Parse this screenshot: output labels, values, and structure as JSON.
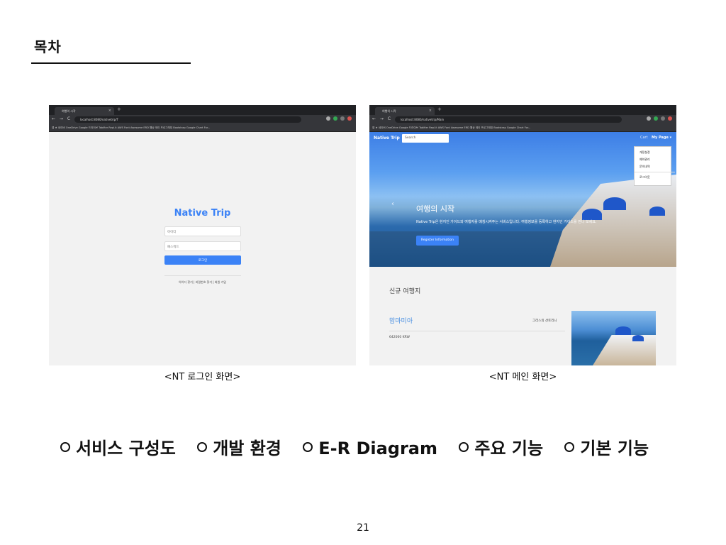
{
  "slide": {
    "title": "목차",
    "page_number": "21"
  },
  "login_screenshot": {
    "browser": {
      "tab_title": "여행의 시작",
      "tab_close": "×",
      "new_tab": "+",
      "nav": "← → C",
      "url": "localhost:8080/nativetrip/T",
      "bookmarks": "앱  ★  네이버  OneDrive  Google 드라이브  Tabifier  Repl.it  AWS  Font Awesome  ERD  웹상 제이 프로그래밍  Bootstrap  Google Chart For..."
    },
    "logo": "Native Trip",
    "id_placeholder": "아이디",
    "pw_placeholder": "패스워드",
    "login_button": "로그인",
    "links": "아이디 찾기  |  비밀번호 찾기  |  회원 가입"
  },
  "main_screenshot": {
    "browser": {
      "tab_title": "여행의 시작",
      "tab_close": "×",
      "new_tab": "+",
      "nav": "← → C",
      "url": "localhost:8080/nativetrip/Main",
      "bookmarks": "앱  ★  네이버  OneDrive  Google 드라이브  Tabifier  Repl.it  AWS  Font Awesome  ERD  웹상 제이 프로그래밍  Bootstrap  Google Chart For..."
    },
    "navbar": {
      "logo": "Native Trip",
      "search_placeholder": "Search",
      "cart": "Cart",
      "my_page": "My Page ▾"
    },
    "dropdown": {
      "items": [
        "개정설정",
        "예약관리",
        "문의내역"
      ],
      "logout": "로그아웃"
    },
    "hero": {
      "prev_arrow": "‹",
      "title": "여행의 시작",
      "description": "Native Trip은 현지인 가이드와 여행자를 매칭시켜주는 서비스입니다. 여행정보를 등록하고 현지인 가이드를 만나 보세요.",
      "button": "Register Information"
    },
    "section_title": "신규 여행지",
    "card": {
      "name": "맘마미아",
      "region": "그리스의 산토리니",
      "price": "642000 KRW"
    }
  },
  "captions": {
    "left": "<NT 로그인 화면>",
    "right": "<NT 메인 화면>"
  },
  "toc_items": [
    "서비스 구성도",
    "개발 환경",
    "E-R Diagram",
    "주요 기능",
    "기본 기능"
  ],
  "colors": {
    "brand_blue": "#3b82f6",
    "browser_dark": "#35363a"
  }
}
